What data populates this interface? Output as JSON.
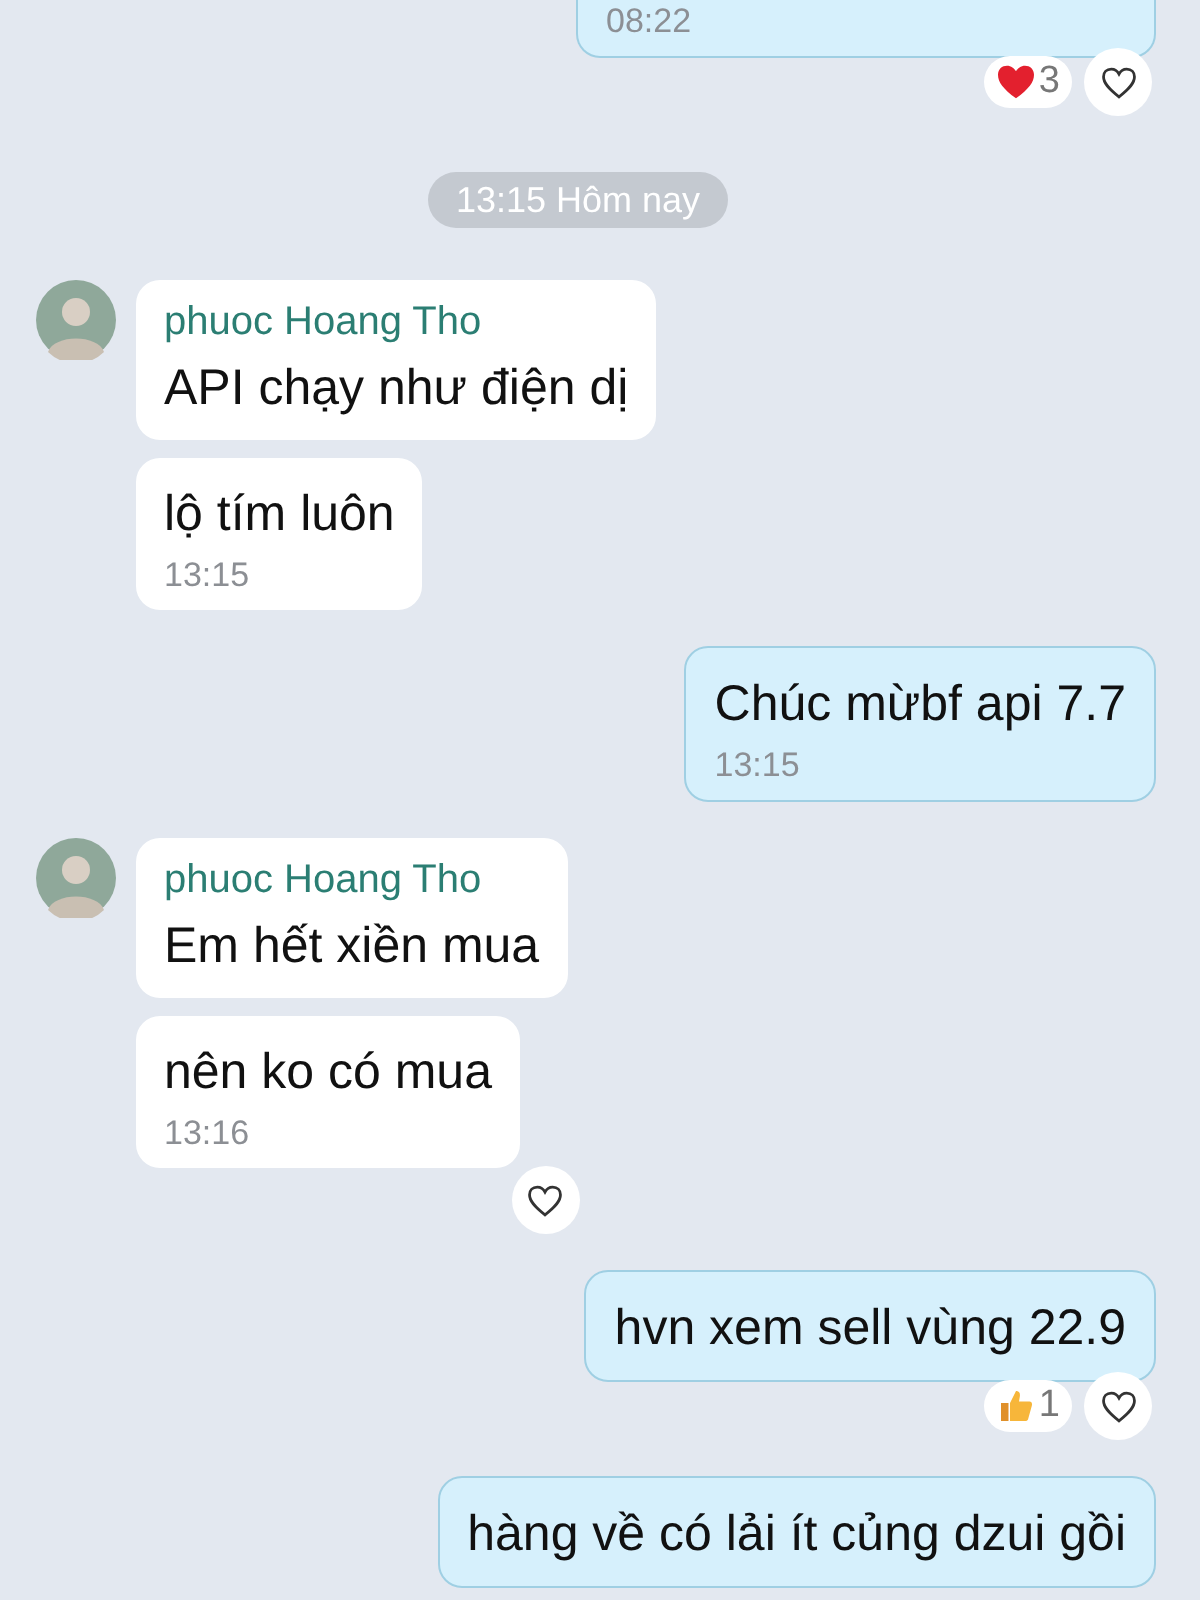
{
  "items": [
    {
      "kind": "outgoing",
      "messages": [
        {
          "time": "08:22"
        }
      ],
      "reactions": [
        {
          "kind": "heart",
          "count": "3"
        }
      ],
      "react_button": true
    },
    {
      "kind": "divider",
      "text": "13:15 Hôm nay"
    },
    {
      "kind": "incoming",
      "sender": "phuoc Hoang Tho",
      "messages": [
        {
          "text": "API chạy như điện dị"
        },
        {
          "text": "lộ tím luôn",
          "time": "13:15"
        }
      ]
    },
    {
      "kind": "outgoing",
      "messages": [
        {
          "text": "Chúc mừbf api 7.7",
          "time": "13:15"
        }
      ]
    },
    {
      "kind": "incoming",
      "sender": "phuoc Hoang Tho",
      "messages": [
        {
          "text": "Em hết xiền mua"
        },
        {
          "text": "nên ko có mua",
          "time": "13:16"
        }
      ],
      "react_button": true
    },
    {
      "kind": "outgoing",
      "messages": [
        {
          "text": "hvn xem sell vùng 22.9"
        }
      ],
      "reactions": [
        {
          "kind": "like",
          "count": "1"
        }
      ],
      "react_button": true
    },
    {
      "kind": "outgoing",
      "messages": [
        {
          "text": "hàng về có lải ít củng dzui gồi"
        }
      ]
    }
  ]
}
